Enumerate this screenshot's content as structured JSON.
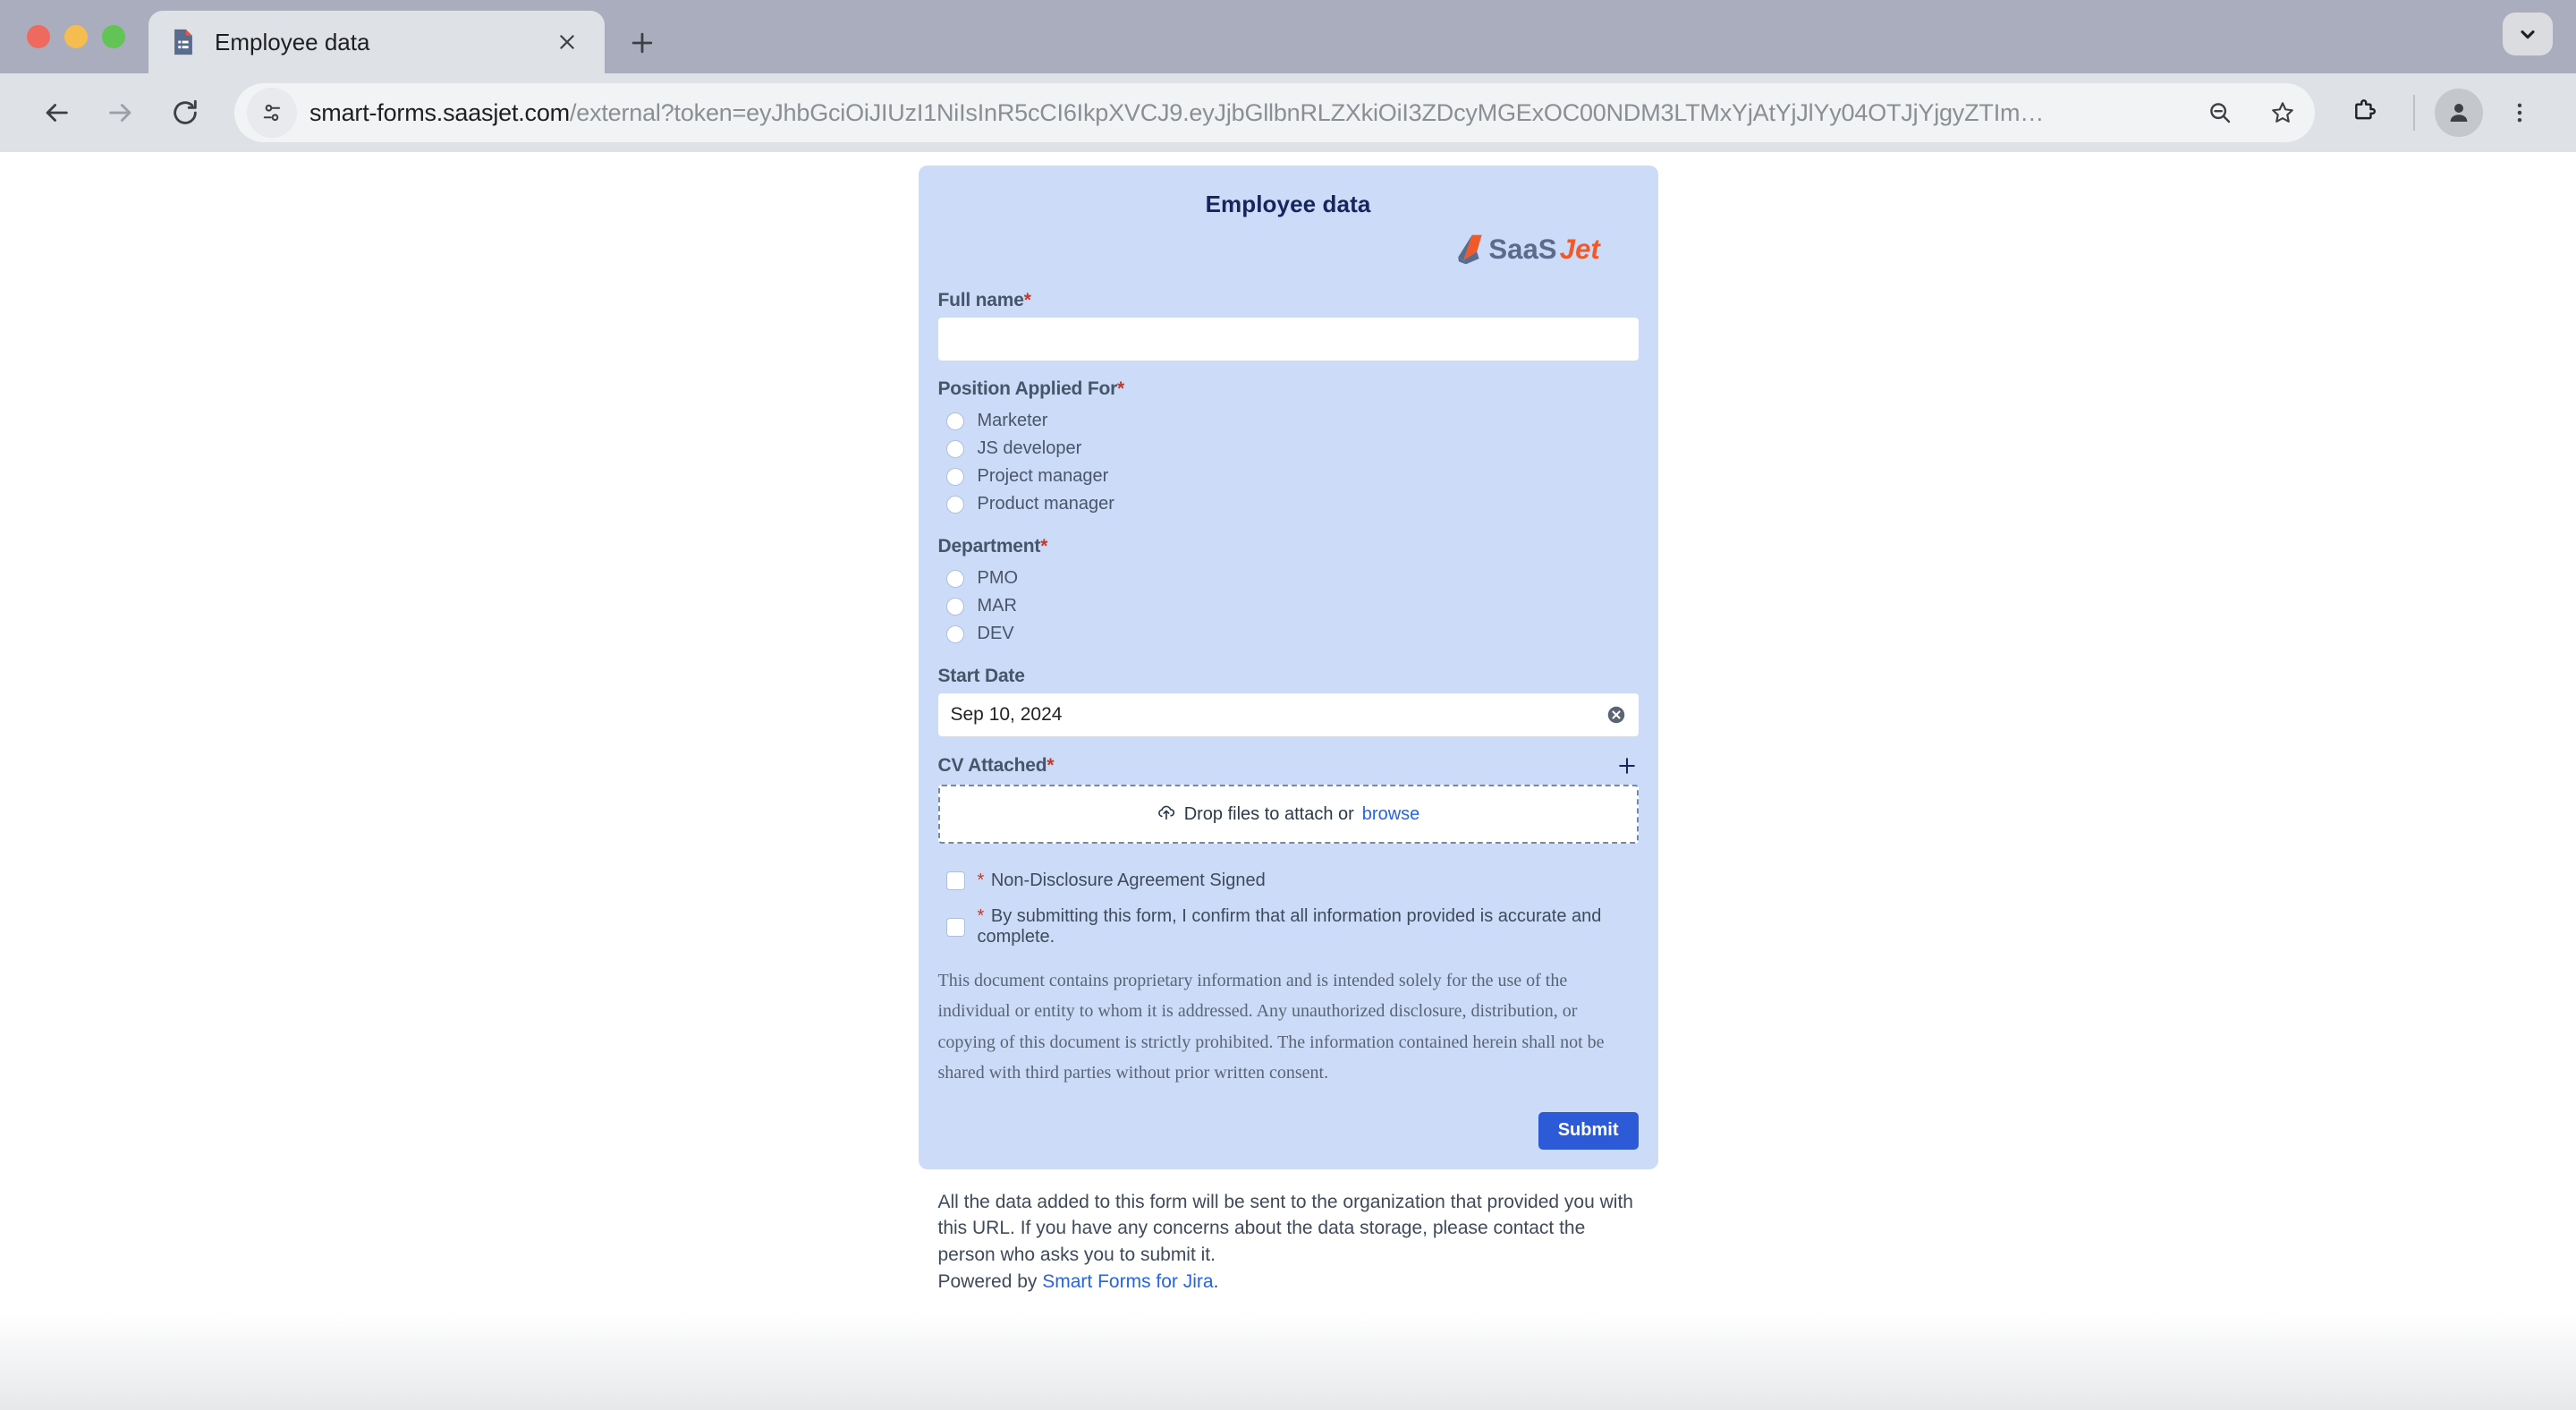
{
  "browser": {
    "tab": {
      "title": "Employee data",
      "favicon_icon": "document-form-icon",
      "close_icon": "close-icon"
    },
    "newtab_icon": "plus-icon",
    "tabsearch_icon": "chevron-down-icon",
    "back_icon": "arrow-left-icon",
    "forward_icon": "arrow-right-icon",
    "reload_icon": "reload-icon",
    "site_info_icon": "page-settings-icon",
    "url_bold": "smart-forms.saasjet.com",
    "url_rest": "/external?token=eyJhbGciOiJIUzI1NiIsInR5cCI6IkpXVCJ9.eyJjbGllbnRLZXkiOiI3ZDcyMGExOC00NDM3LTMxYjAtYjJlYy04OTJjYjgyZTIm…",
    "zoom_out_icon": "zoom-out-magnifier-icon",
    "bookmark_icon": "star-icon",
    "extensions_icon": "puzzle-piece-icon",
    "profile_icon": "person-avatar-icon",
    "menu_icon": "kebab-menu-icon"
  },
  "form": {
    "title": "Employee data",
    "logo_text_primary": "SaaS",
    "logo_text_accent": "Jet",
    "fullname": {
      "label": "Full name",
      "required": "*",
      "value": "",
      "placeholder": ""
    },
    "position": {
      "label": "Position Applied For",
      "required": "*",
      "options": [
        "Marketer",
        "JS developer",
        "Project manager",
        "Product manager"
      ]
    },
    "department": {
      "label": "Department",
      "required": "*",
      "options": [
        "PMO",
        "MAR",
        "DEV"
      ]
    },
    "start_date": {
      "label": "Start Date",
      "value": "Sep 10, 2024",
      "clear_icon": "clear-circle-icon"
    },
    "cv": {
      "label": "CV Attached",
      "required": "*",
      "add_icon": "plus-icon",
      "upload_icon": "cloud-upload-icon",
      "drop_text": "Drop files to attach or",
      "browse_link": "browse"
    },
    "checkboxes": [
      {
        "required": "*",
        "label": "Non-Disclosure Agreement Signed"
      },
      {
        "required": "*",
        "label": "By submitting this form, I confirm that all information provided is accurate and complete."
      }
    ],
    "disclaimer": "This document contains proprietary information and is intended solely for the use of the individual or entity to whom it is addressed. Any unauthorized disclosure, distribution, or copying of this document is strictly prohibited. The information contained herein shall not be shared with third parties without prior written consent.",
    "submit_label": "Submit"
  },
  "footer": {
    "line1": "All the data added to this form will be sent to the organization that provided you with this URL. If you have any concerns about the data storage, please contact the person who asks you to submit it.",
    "powered_prefix": "Powered by ",
    "powered_link": "Smart Forms for Jira",
    "powered_suffix": "."
  },
  "colors": {
    "card_bg": "#cbdbf8",
    "accent_blue": "#2d5bd7",
    "link_blue": "#2563eb",
    "required_red": "#c0392b",
    "logo_orange": "#f05a28",
    "logo_slate": "#5b6b8c",
    "title_navy": "#17255c"
  }
}
